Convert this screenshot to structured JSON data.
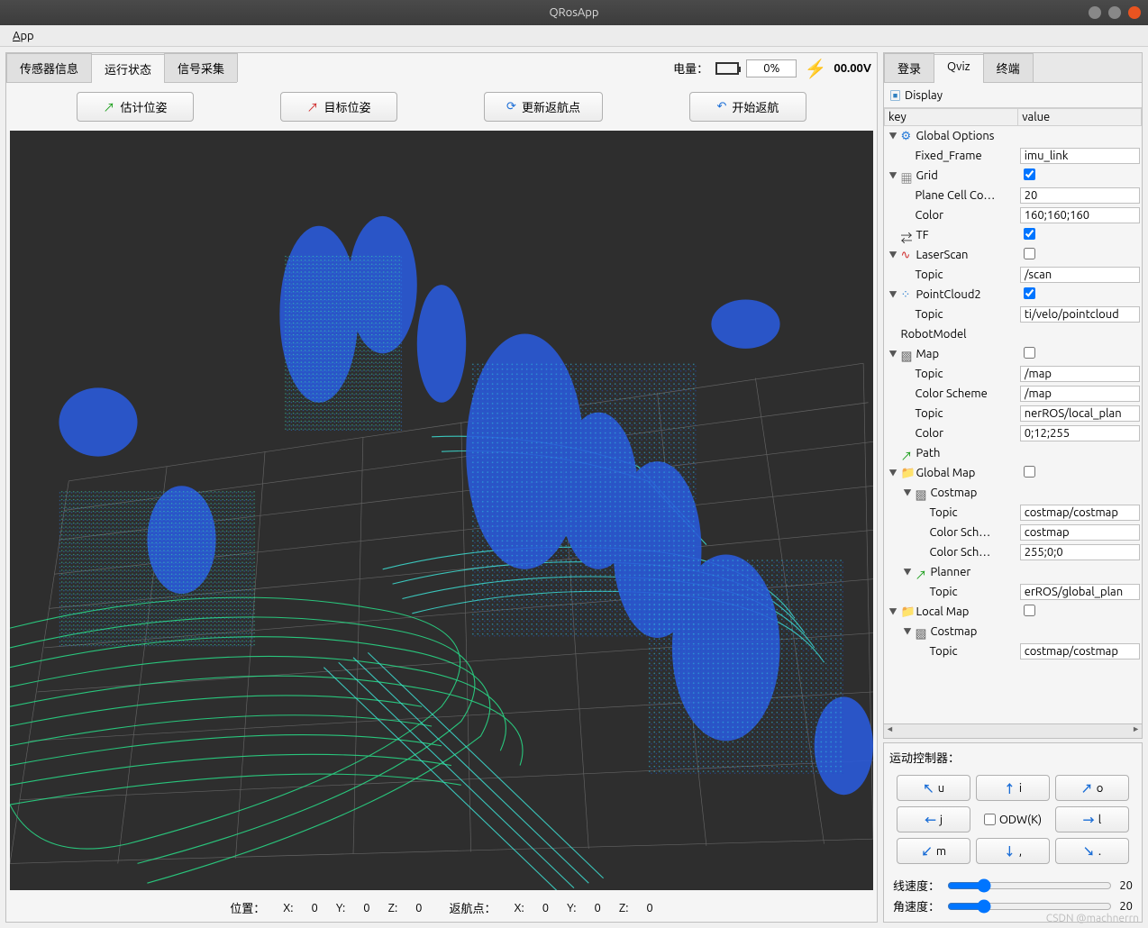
{
  "window": {
    "title": "QRosApp",
    "menu_app": "App"
  },
  "left_tabs": {
    "t0": "传感器信息",
    "t1": "运行状态",
    "t2": "信号采集"
  },
  "battery": {
    "label": "电量：",
    "percent": "0%",
    "voltage": "00.00V"
  },
  "action_buttons": {
    "b0": "估计位姿",
    "b1": "目标位姿",
    "b2": "更新返航点",
    "b3": "开始返航"
  },
  "status": {
    "pos_label": "位置：",
    "x_label": "X:",
    "y_label": "Y:",
    "z_label": "Z:",
    "pos_x": "0",
    "pos_y": "0",
    "pos_z": "0",
    "ret_label": "返航点：",
    "ret_x": "0",
    "ret_y": "0",
    "ret_z": "0"
  },
  "right_tabs": {
    "t0": "登录",
    "t1": "Qviz",
    "t2": "终端"
  },
  "display": {
    "header": "Display",
    "col_key": "key",
    "col_val": "value",
    "rows": [
      {
        "ind": 0,
        "exp": "▼",
        "ico": "gear",
        "k": "Global Options",
        "v": "",
        "type": "none"
      },
      {
        "ind": 1,
        "exp": "",
        "ico": "",
        "k": "Fixed_Frame",
        "v": "imu_link",
        "type": "text"
      },
      {
        "ind": 0,
        "exp": "▼",
        "ico": "grid",
        "k": "Grid",
        "v": "1",
        "type": "check"
      },
      {
        "ind": 1,
        "exp": "",
        "ico": "",
        "k": "Plane Cell Co…",
        "v": "20",
        "type": "text"
      },
      {
        "ind": 1,
        "exp": "",
        "ico": "",
        "k": "Color",
        "v": "160;160;160",
        "type": "text"
      },
      {
        "ind": 0,
        "exp": "",
        "ico": "tf",
        "k": "TF",
        "v": "1",
        "type": "check"
      },
      {
        "ind": 0,
        "exp": "▼",
        "ico": "wave",
        "k": "LaserScan",
        "v": "0",
        "type": "check"
      },
      {
        "ind": 1,
        "exp": "",
        "ico": "",
        "k": "Topic",
        "v": "/scan",
        "type": "text"
      },
      {
        "ind": 0,
        "exp": "▼",
        "ico": "dots",
        "k": "PointCloud2",
        "v": "1",
        "type": "check"
      },
      {
        "ind": 1,
        "exp": "",
        "ico": "",
        "k": "Topic",
        "v": "ti/velo/pointcloud",
        "type": "text"
      },
      {
        "ind": 0,
        "exp": "",
        "ico": "",
        "k": "RobotModel",
        "v": "",
        "type": "none"
      },
      {
        "ind": 0,
        "exp": "▼",
        "ico": "map",
        "k": "Map",
        "v": "0",
        "type": "check"
      },
      {
        "ind": 1,
        "exp": "",
        "ico": "",
        "k": "Topic",
        "v": "/map",
        "type": "text"
      },
      {
        "ind": 1,
        "exp": "",
        "ico": "",
        "k": "Color Scheme",
        "v": "/map",
        "type": "text"
      },
      {
        "ind": 1,
        "exp": "",
        "ico": "",
        "k": "Topic",
        "v": "nerROS/local_plan",
        "type": "text"
      },
      {
        "ind": 1,
        "exp": "",
        "ico": "",
        "k": "Color",
        "v": "0;12;255",
        "type": "text"
      },
      {
        "ind": 0,
        "exp": "",
        "ico": "path",
        "k": "Path",
        "v": "",
        "type": "none"
      },
      {
        "ind": 0,
        "exp": "▼",
        "ico": "folder",
        "k": "Global Map",
        "v": "0",
        "type": "check"
      },
      {
        "ind": 1,
        "exp": "▼",
        "ico": "map",
        "k": "Costmap",
        "v": "",
        "type": "none"
      },
      {
        "ind": 2,
        "exp": "",
        "ico": "",
        "k": "Topic",
        "v": "costmap/costmap",
        "type": "text"
      },
      {
        "ind": 2,
        "exp": "",
        "ico": "",
        "k": "Color Sch…",
        "v": "costmap",
        "type": "text"
      },
      {
        "ind": 2,
        "exp": "",
        "ico": "",
        "k": "Color Sch…",
        "v": "255;0;0",
        "type": "text"
      },
      {
        "ind": 1,
        "exp": "▼",
        "ico": "path",
        "k": "Planner",
        "v": "",
        "type": "none"
      },
      {
        "ind": 2,
        "exp": "",
        "ico": "",
        "k": "Topic",
        "v": "erROS/global_plan",
        "type": "text"
      },
      {
        "ind": 0,
        "exp": "▼",
        "ico": "folder",
        "k": "Local Map",
        "v": "0",
        "type": "check"
      },
      {
        "ind": 1,
        "exp": "▼",
        "ico": "map",
        "k": "Costmap",
        "v": "",
        "type": "none"
      },
      {
        "ind": 2,
        "exp": "",
        "ico": "",
        "k": "Topic",
        "v": "costmap/costmap",
        "type": "text"
      }
    ]
  },
  "motion": {
    "title": "运动控制器：",
    "keys": {
      "u": "u",
      "i": "i",
      "o": "o",
      "j": "j",
      "l": "l",
      "m": "m",
      "comma": ",",
      "dot": "."
    },
    "odw": "ODW(K)",
    "lin_label": "线速度：",
    "lin_val": "20",
    "ang_label": "角速度：",
    "ang_val": "20"
  },
  "watermark": "CSDN @machnerrn"
}
